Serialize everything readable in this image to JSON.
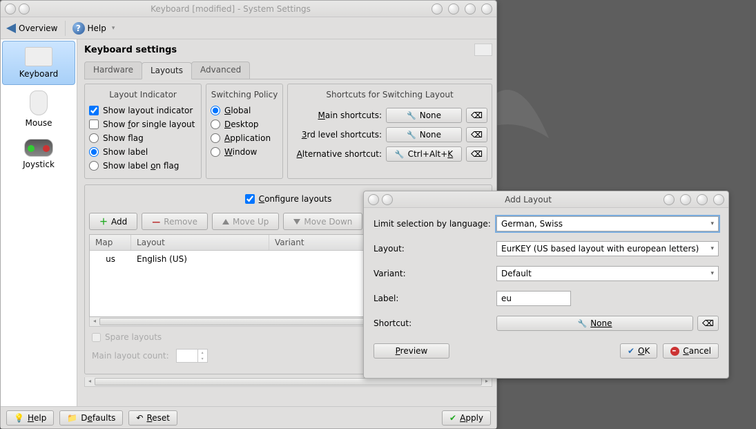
{
  "window": {
    "title": "Keyboard [modified] - System Settings"
  },
  "toolbar": {
    "overview": "Overview",
    "help": "Help"
  },
  "sidebar": {
    "items": [
      {
        "label": "Keyboard",
        "selected": true
      },
      {
        "label": "Mouse",
        "selected": false
      },
      {
        "label": "Joystick",
        "selected": false
      }
    ]
  },
  "page": {
    "title": "Keyboard settings",
    "tabs": [
      "Hardware",
      "Layouts",
      "Advanced"
    ],
    "active_tab": 1
  },
  "layout_indicator": {
    "title": "Layout Indicator",
    "show_indicator": "Show layout indicator",
    "show_single": "Show for single layout",
    "show_flag": "Show flag",
    "show_label": "Show label",
    "show_label_on_flag": "Show label on flag"
  },
  "switching_policy": {
    "title": "Switching Policy",
    "opts": [
      "Global",
      "Desktop",
      "Application",
      "Window"
    ]
  },
  "shortcuts": {
    "title": "Shortcuts for Switching Layout",
    "main_label": "Main shortcuts:",
    "third_label": "3rd level shortcuts:",
    "alt_label": "Alternative shortcut:",
    "none": "None",
    "alt_value": "Ctrl+Alt+K"
  },
  "configure": {
    "label": "Configure layouts",
    "buttons": {
      "add": "Add",
      "remove": "Remove",
      "moveup": "Move Up",
      "movedown": "Move Down"
    },
    "columns": [
      "Map",
      "Layout",
      "Variant"
    ],
    "rows": [
      {
        "map": "us",
        "layout": "English (US)",
        "variant": ""
      }
    ],
    "spare": "Spare layouts",
    "main_count": "Main layout count:"
  },
  "bottom": {
    "help": "Help",
    "defaults": "Defaults",
    "reset": "Reset",
    "apply": "Apply"
  },
  "dialog": {
    "title": "Add Layout",
    "limit_label": "Limit selection by language:",
    "limit_value": "German, Swiss",
    "layout_label": "Layout:",
    "layout_value": "EurKEY (US based layout with european letters)",
    "variant_label": "Variant:",
    "variant_value": "Default",
    "label_label": "Label:",
    "label_value": "eu",
    "shortcut_label": "Shortcut:",
    "shortcut_value": "None",
    "preview": "Preview",
    "ok": "OK",
    "cancel": "Cancel"
  }
}
